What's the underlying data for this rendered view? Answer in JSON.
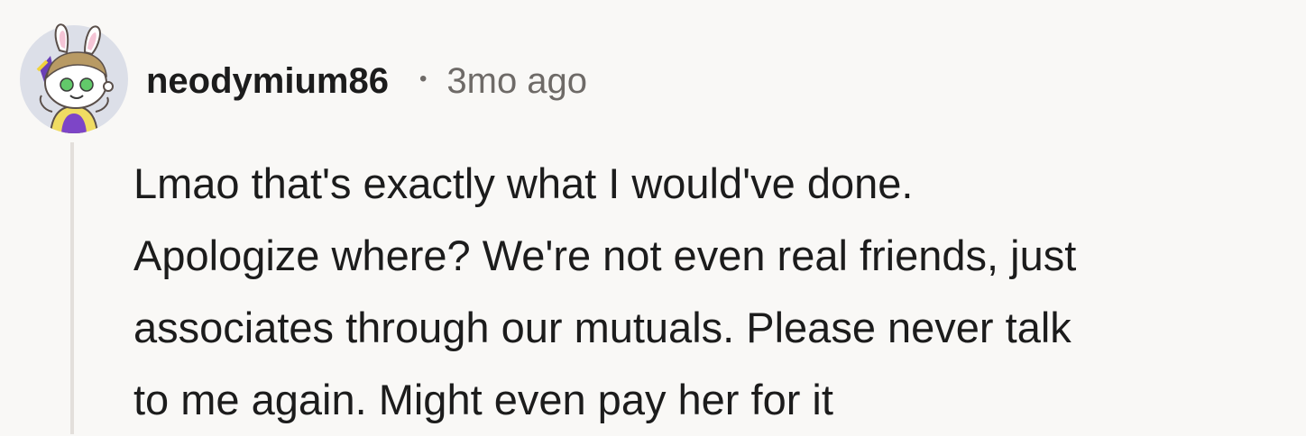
{
  "comment": {
    "author": "neodymium86",
    "separator": "•",
    "time": "3mo ago",
    "avatar_icon": "snoo-avatar-bunny-ears",
    "body_lines": [
      "Lmao that's exactly what I would've done.",
      "Apologize where? We're not even real friends, just",
      "associates through our mutuals. Please never talk",
      "to me again. Might even pay her for it"
    ]
  }
}
